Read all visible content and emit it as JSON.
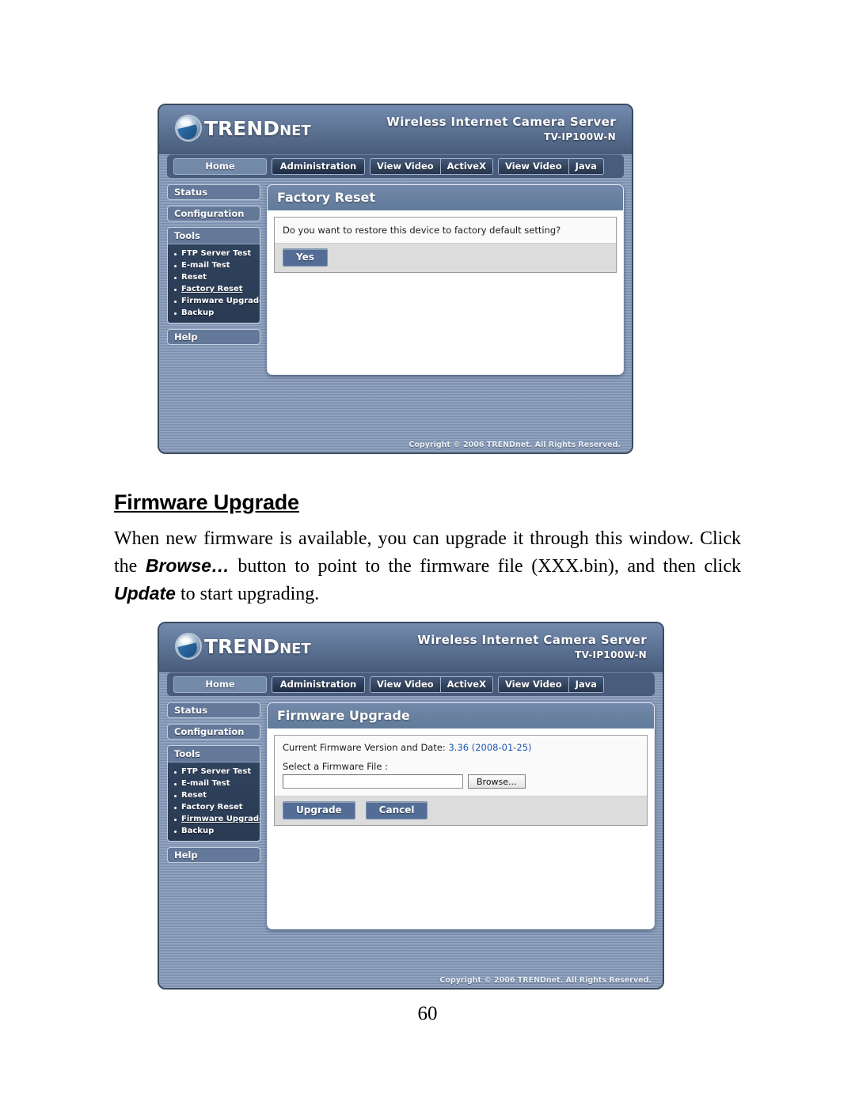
{
  "document": {
    "heading": "Firmware Upgrade",
    "paragraph": {
      "part1": "When new firmware is available, you can upgrade it through this window.  Click the ",
      "emphasis1": "Browse…",
      "part2": " button to point to the firmware file (XXX.bin), and then click ",
      "emphasis2": "Update",
      "part3": " to start upgrading."
    },
    "page_number": "60"
  },
  "screenshot_factory_reset": {
    "header": {
      "brand": "TREND",
      "brand_suffix": "net",
      "product_title": "Wireless Internet Camera Server",
      "model": "TV-IP100W-N"
    },
    "nav": {
      "home": "Home",
      "administration": "Administration",
      "view_video_1": "View Video",
      "activex": "ActiveX",
      "view_video_2": "View Video",
      "java": "Java"
    },
    "sidebar": {
      "status": "Status",
      "configuration": "Configuration",
      "tools": "Tools",
      "tools_items": [
        {
          "label": "FTP Server Test",
          "active": false
        },
        {
          "label": "E-mail Test",
          "active": false
        },
        {
          "label": "Reset",
          "active": false
        },
        {
          "label": "Factory Reset",
          "active": true
        },
        {
          "label": "Firmware Upgrade",
          "active": false
        },
        {
          "label": "Backup",
          "active": false
        }
      ],
      "help": "Help"
    },
    "panel": {
      "title": "Factory Reset",
      "question": "Do you want to restore this device to factory default setting?",
      "yes_button": "Yes"
    },
    "footer": "Copyright © 2006 TRENDnet. All Rights Reserved."
  },
  "screenshot_firmware_upgrade": {
    "header": {
      "brand": "TREND",
      "brand_suffix": "net",
      "product_title": "Wireless Internet Camera Server",
      "model": "TV-IP100W-N"
    },
    "nav": {
      "home": "Home",
      "administration": "Administration",
      "view_video_1": "View Video",
      "activex": "ActiveX",
      "view_video_2": "View Video",
      "java": "Java"
    },
    "sidebar": {
      "status": "Status",
      "configuration": "Configuration",
      "tools": "Tools",
      "tools_items": [
        {
          "label": "FTP Server Test",
          "active": false
        },
        {
          "label": "E-mail Test",
          "active": false
        },
        {
          "label": "Reset",
          "active": false
        },
        {
          "label": "Factory Reset",
          "active": false
        },
        {
          "label": "Firmware Upgrade",
          "active": true
        },
        {
          "label": "Backup",
          "active": false
        }
      ],
      "help": "Help"
    },
    "panel": {
      "title": "Firmware Upgrade",
      "version_label": "Current Firmware Version and Date:",
      "version_value": "3.36 (2008-01-25)",
      "file_label": "Select a Firmware File :",
      "file_value": "",
      "file_placeholder": "",
      "browse_button": "Browse...",
      "upgrade_button": "Upgrade",
      "cancel_button": "Cancel"
    },
    "footer": "Copyright © 2006 TRENDnet. All Rights Reserved."
  },
  "colors": {
    "panel_header": "#6b83a4",
    "accent_blue": "#1a56b0",
    "chrome_blue": "#53_6d96"
  }
}
